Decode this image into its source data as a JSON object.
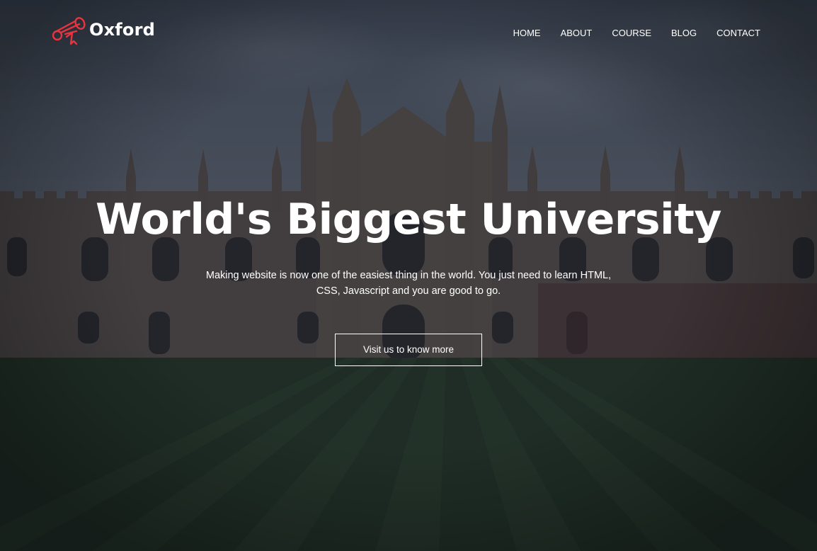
{
  "brand": {
    "name": "Oxford",
    "icon": "graduation-scroll-icon",
    "accent_color": "#e8343f"
  },
  "nav": {
    "items": [
      {
        "label": "HOME"
      },
      {
        "label": "ABOUT"
      },
      {
        "label": "COURSE"
      },
      {
        "label": "BLOG"
      },
      {
        "label": "CONTACT"
      }
    ]
  },
  "hero": {
    "title": "World's Biggest University",
    "subtitle": "Making website is now one of the easiest thing in the world. You just need to learn HTML, CSS, Javascript and you are good to go.",
    "cta_label": "Visit us to know more",
    "background": "university-building-photo"
  }
}
